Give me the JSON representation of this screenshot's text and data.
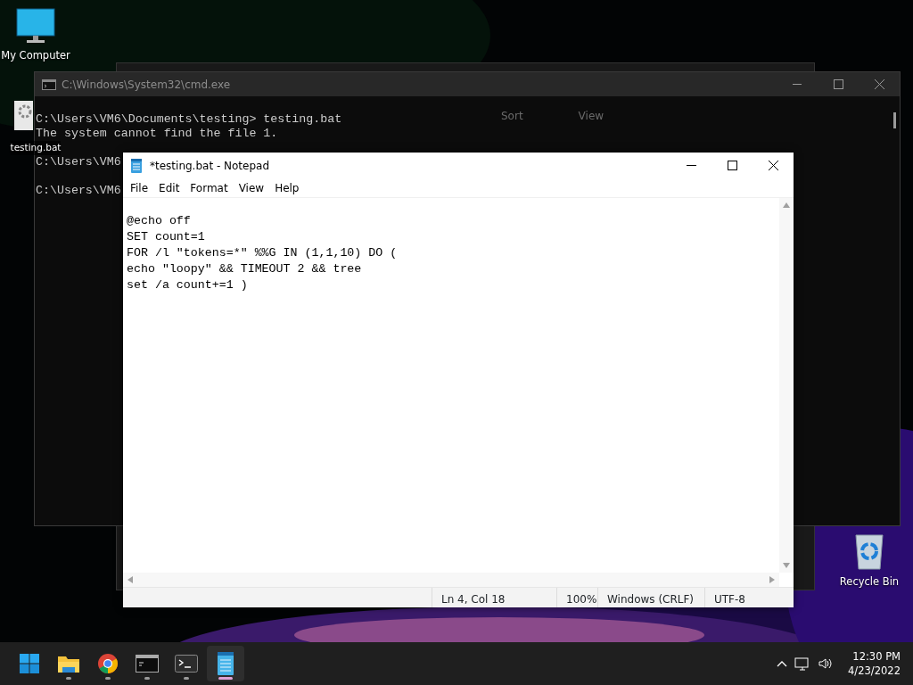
{
  "desktop_icons": [
    {
      "kind": "computer",
      "label": "My Computer"
    },
    {
      "kind": "file",
      "label": "testing.bat"
    },
    {
      "kind": "recycle",
      "label": "Recycle Bin"
    }
  ],
  "explorer": {
    "toolbar": [
      "Sort",
      "View"
    ]
  },
  "cmd": {
    "title": "C:\\Windows\\System32\\cmd.exe",
    "lines": [
      "C:\\Users\\VM6\\Documents\\testing> testing.bat",
      "The system cannot find the file 1.",
      "C:\\Users\\VM6",
      "C:\\Users\\VM6"
    ]
  },
  "notepad": {
    "title": "*testing.bat - Notepad",
    "menu": [
      "File",
      "Edit",
      "Format",
      "View",
      "Help"
    ],
    "lines": [
      "@echo off",
      "SET count=1",
      "FOR /l \"tokens=*\" %%G IN (1,1,10) DO (",
      "echo \"loopy\" && TIMEOUT 2 && tree",
      "set /a count+=1 )"
    ],
    "status": [
      "Ln 4, Col 18",
      "100%",
      "Windows (CRLF)",
      "UTF-8"
    ]
  },
  "taskbar": {
    "apps": [
      {
        "kind": "start",
        "selected": false,
        "running": false
      },
      {
        "kind": "folder",
        "selected": false,
        "running": true
      },
      {
        "kind": "browser",
        "selected": false,
        "running": true
      },
      {
        "kind": "cmd",
        "selected": false,
        "running": true
      },
      {
        "kind": "terminal",
        "selected": false,
        "running": true
      },
      {
        "kind": "notepad",
        "selected": true,
        "running": true
      }
    ],
    "time": "12:30 PM",
    "date": "4/23/2022"
  }
}
